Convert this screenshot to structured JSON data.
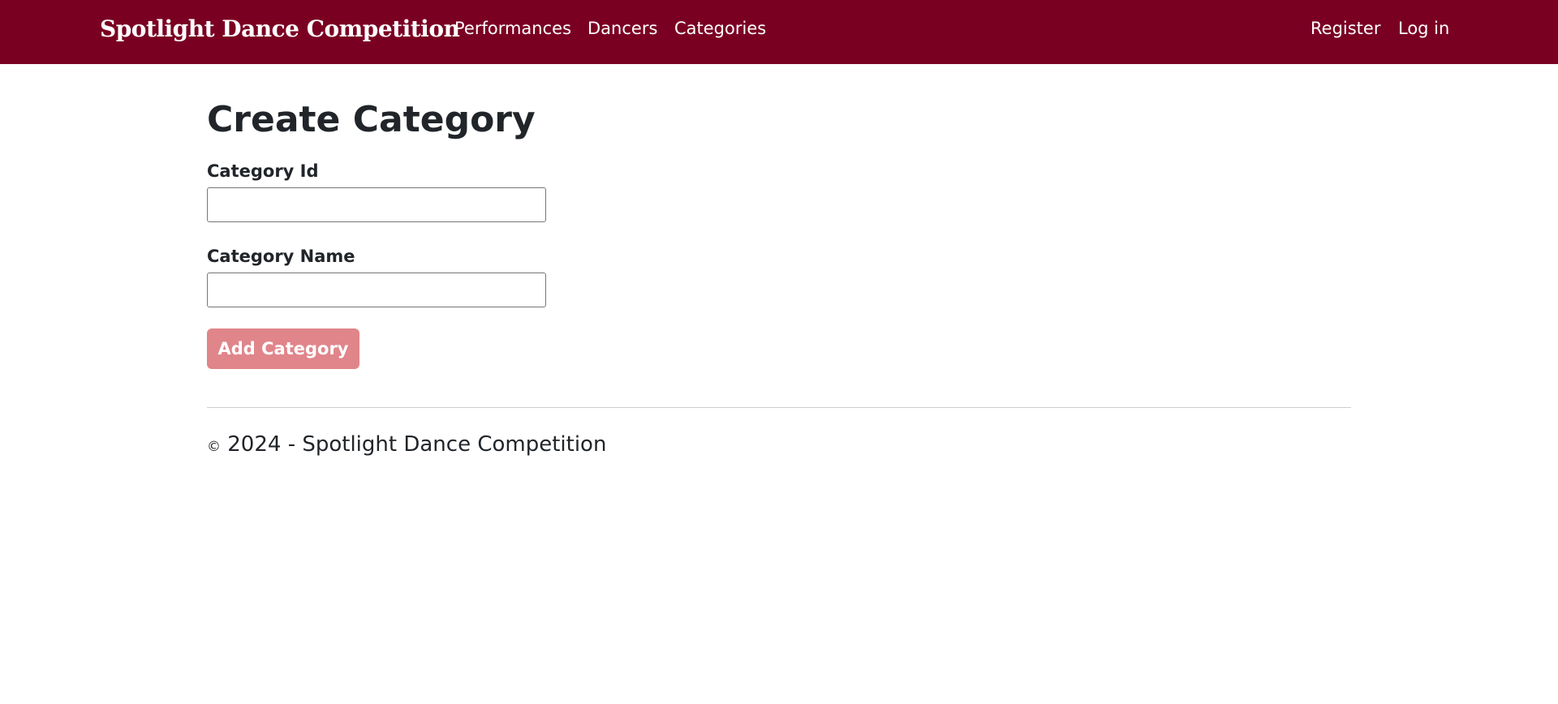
{
  "navbar": {
    "brand": "Spotlight Dance Competition",
    "links": [
      "Performances",
      "Dancers",
      "Categories"
    ],
    "auth": {
      "register": "Register",
      "login": "Log in"
    },
    "background_color": "#7a0022"
  },
  "main": {
    "title": "Create Category",
    "fields": [
      {
        "label": "Category Id",
        "value": "",
        "placeholder": ""
      },
      {
        "label": "Category Name",
        "value": "",
        "placeholder": ""
      }
    ],
    "submit_label": "Add Category",
    "submit_color": "#e0858a"
  },
  "footer": {
    "copyright_symbol": "©",
    "text": "2024 - Spotlight Dance Competition"
  }
}
